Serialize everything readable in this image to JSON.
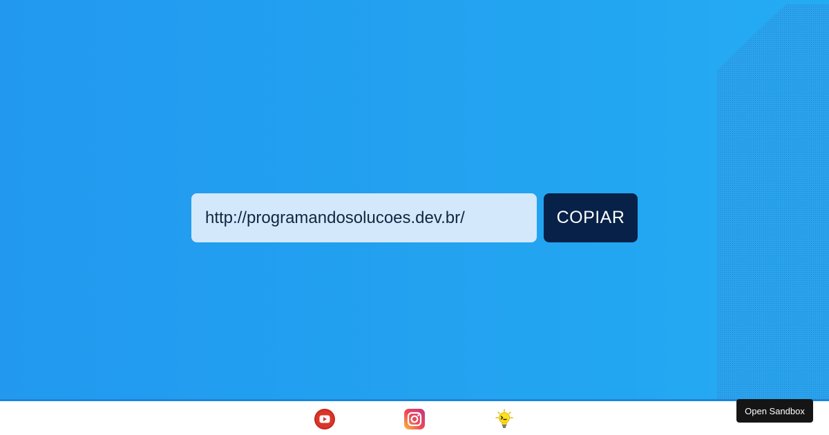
{
  "main": {
    "url_input": {
      "value": "http://programandosolucoes.dev.br/"
    },
    "copy_button_label": "COPIAR"
  },
  "footer": {
    "links": [
      {
        "name": "youtube",
        "icon": "youtube-icon"
      },
      {
        "name": "instagram",
        "icon": "instagram-icon"
      },
      {
        "name": "blog",
        "icon": "lightbulb-icon"
      }
    ]
  },
  "sandbox": {
    "button_label": "Open Sandbox"
  },
  "colors": {
    "background": "#2299ef",
    "input_background": "#d4e8fc",
    "button_background": "#082148",
    "footer_background": "#ffffff",
    "sandbox_button_background": "#151515"
  }
}
